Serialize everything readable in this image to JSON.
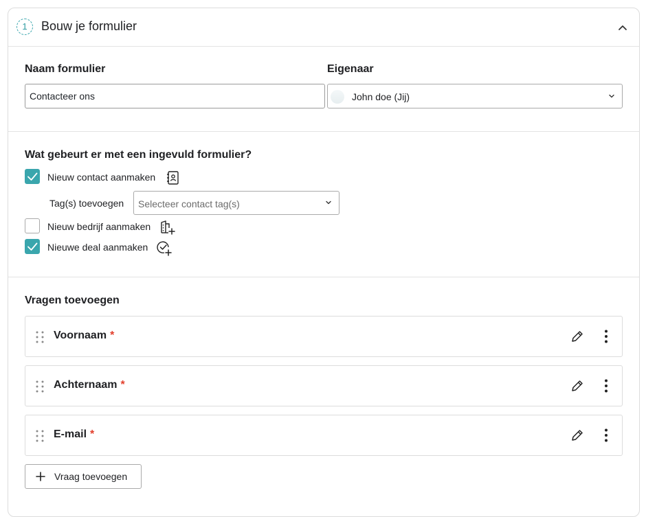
{
  "section": {
    "step_number": "1",
    "title": "Bouw je formulier"
  },
  "form": {
    "name_label": "Naam formulier",
    "name_value": "Contacteer ons",
    "owner_label": "Eigenaar",
    "owner_value": "John doe (Jij)"
  },
  "actions": {
    "heading": "Wat gebeurt er met een ingevuld formulier?",
    "new_contact": {
      "label": "Nieuw contact aanmaken",
      "checked": true,
      "icon": "contact-book-icon"
    },
    "tags": {
      "label": "Tag(s) toevoegen",
      "placeholder": "Selecteer contact tag(s)"
    },
    "new_company": {
      "label": "Nieuw bedrijf aanmaken",
      "checked": false,
      "icon": "building-add-icon"
    },
    "new_deal": {
      "label": "Nieuwe deal aanmaken",
      "checked": true,
      "icon": "check-circle-add-icon"
    }
  },
  "questions": {
    "heading": "Vragen toevoegen",
    "items": [
      {
        "label": "Voornaam",
        "required_mark": "*"
      },
      {
        "label": "Achternaam",
        "required_mark": "*"
      },
      {
        "label": "E-mail",
        "required_mark": "*"
      }
    ],
    "add_button_label": "Vraag toevoegen"
  },
  "colors": {
    "accent": "#3aa6ad",
    "required": "#e23e2b",
    "border": "#dcdcdc"
  }
}
